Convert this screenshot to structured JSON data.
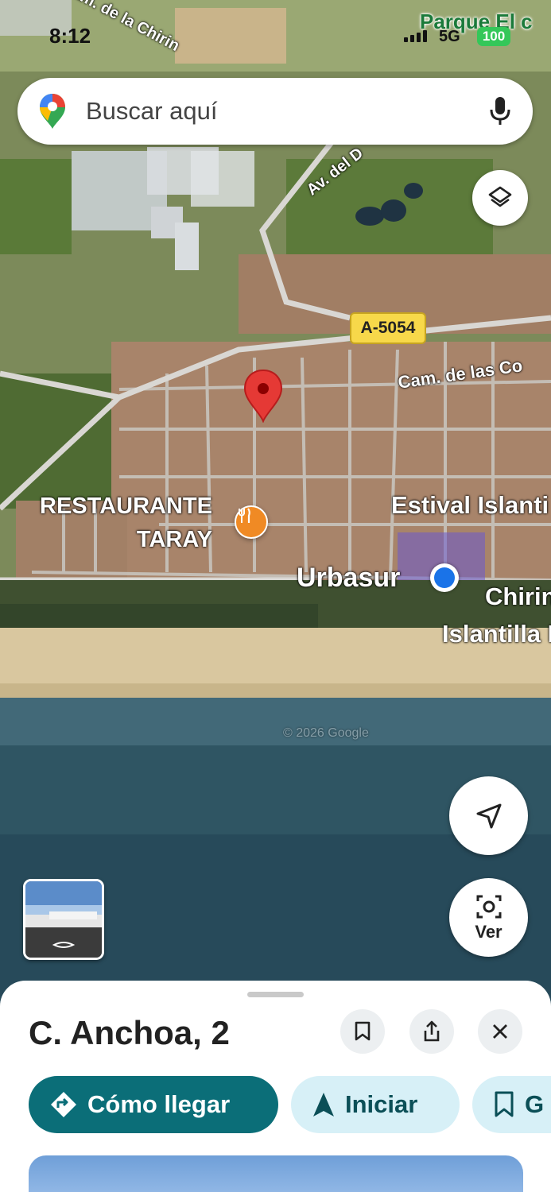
{
  "status_bar": {
    "time": "8:12",
    "network": "5G",
    "battery": "100"
  },
  "search": {
    "placeholder": "Buscar aquí"
  },
  "map": {
    "labels": {
      "park": "Parque El c",
      "street_top": "Cam. de la Chirin",
      "avenue": "Av. del D",
      "road_shield": "A-5054",
      "street_right": "Cam. de las Co",
      "restaurant": "RESTAURANTE\nTARAY",
      "hotel": "Estival Islanti",
      "area": "Urbasur",
      "beach_1": "Chirin",
      "beach_2": "Islantilla I",
      "copyright": "© 2026 Google"
    }
  },
  "buttons": {
    "view_label": "Ver"
  },
  "place_sheet": {
    "title": "C. Anchoa, 2",
    "actions": {
      "directions": "Cómo llegar",
      "start": "Iniciar",
      "save": "G"
    }
  },
  "colors": {
    "primary_teal": "#0b6e78",
    "chip_light": "#d7f0f7",
    "pin_red": "#e53935",
    "location_blue": "#1a73e8"
  }
}
